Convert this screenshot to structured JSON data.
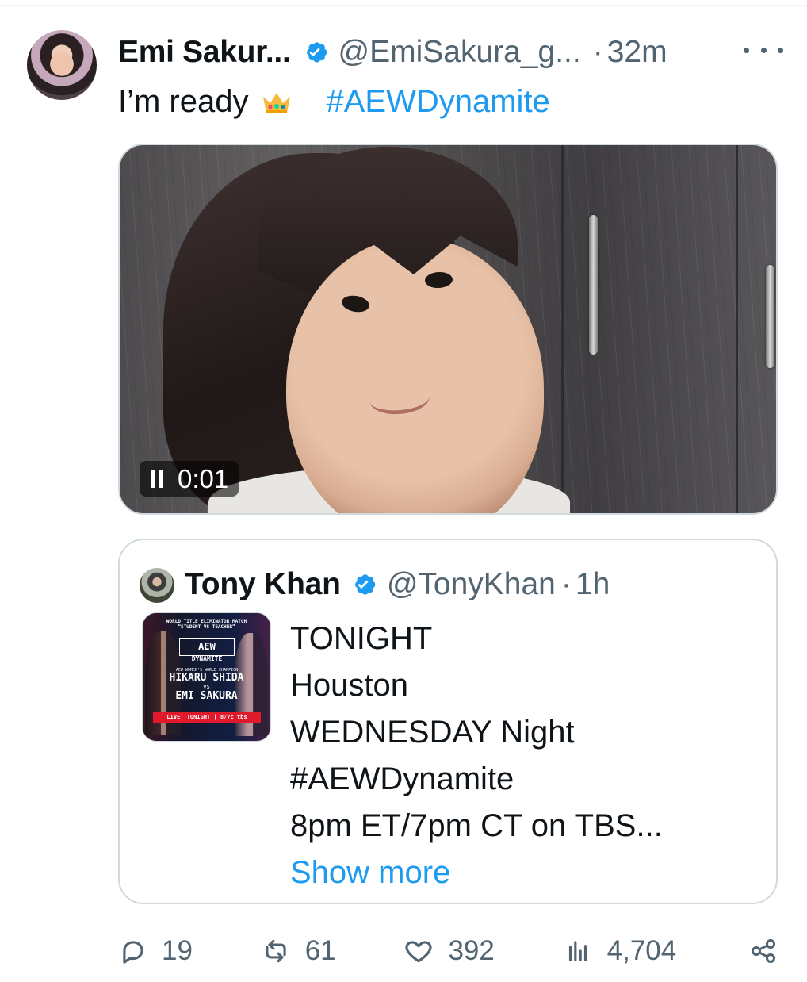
{
  "tweet": {
    "author_name": "Emi Sakur...",
    "handle": "@EmiSakura_g...",
    "separator": "·",
    "time": "32m",
    "text": "I’m ready",
    "hashtag": "#AEWDynamite"
  },
  "media": {
    "video_time": "0:01"
  },
  "quoted_tweet": {
    "author_name": "Tony Khan",
    "handle": "@TonyKhan",
    "separator": "·",
    "time": "1h",
    "lines": [
      "TONIGHT",
      "Houston",
      "WEDNESDAY Night",
      "#AEWDynamite",
      "8pm ET/7pm CT on TBS..."
    ],
    "show_more": "Show more",
    "poster": {
      "title": "WORLD TITLE ELIMINATOR MATCH “STUDENT VS TEACHER”",
      "logo": "AEW",
      "show": "DYNAMITE",
      "champion_label": "AEW WOMEN’S WORLD CHAMPION",
      "wrestler_1": "HIKARU SHIDA",
      "vs": "VS",
      "wrestler_2": "EMI SAKURA",
      "bottom_text": "LIVE! TONIGHT | 8/7c tbs"
    }
  },
  "actions": {
    "replies": "19",
    "reposts": "61",
    "likes": "392",
    "views": "4,704"
  },
  "colors": {
    "link": "#1d9bf0",
    "muted": "#536471",
    "border": "#cfd9de"
  }
}
